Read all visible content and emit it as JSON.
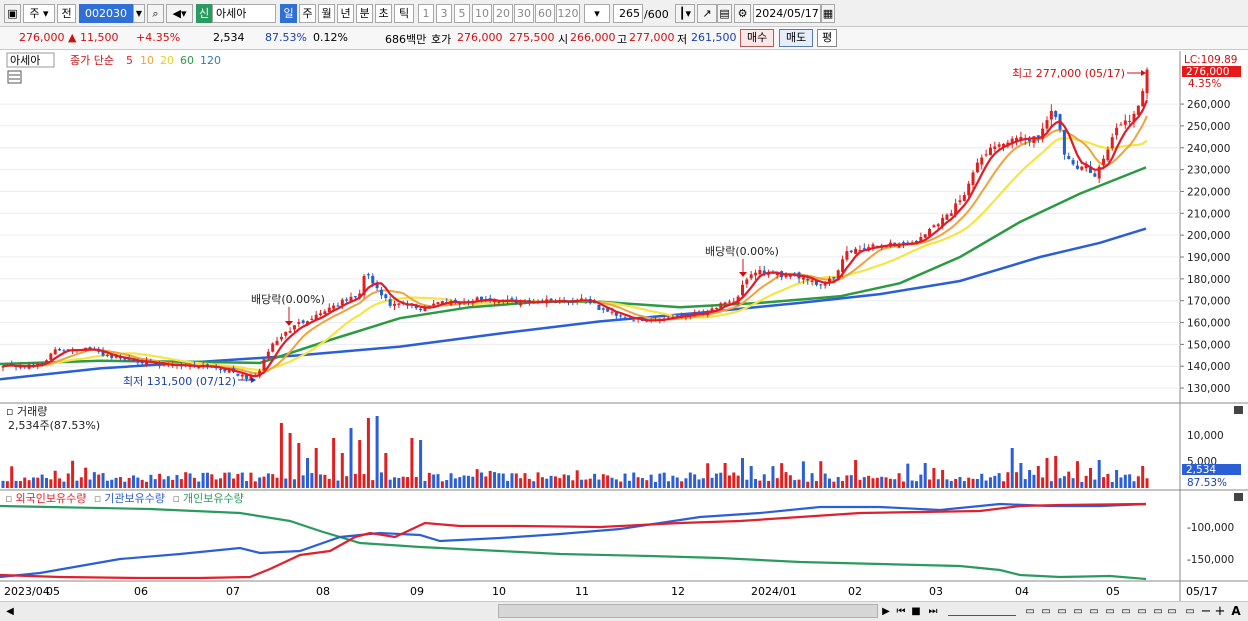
{
  "toolbar": {
    "market_type": "주",
    "prev_label": "전",
    "code": "002030",
    "search_icon": "magnifier-icon",
    "sound_icon": "speaker-icon",
    "new_label": "신",
    "stock_name": "아세아",
    "periods": [
      "일",
      "주",
      "월",
      "년",
      "분",
      "초",
      "틱"
    ],
    "selected_period": "일",
    "intervals": [
      "1",
      "3",
      "5",
      "10",
      "20",
      "30",
      "60",
      "120"
    ],
    "count": "265",
    "total": "/600",
    "date": "2024/05/17"
  },
  "infobar": {
    "price": "276,000",
    "change": "▲ 11,500",
    "change_pct": "+4.35%",
    "volume": "2,534",
    "volume_ratio": "87.53%",
    "turnover": "0.12%",
    "trade_value": "686백만",
    "bid_label": "호가",
    "bid": "276,000",
    "ask": "275,500",
    "open_label": "시",
    "open": "266,000",
    "high_label": "고",
    "high": "277,000",
    "low_label": "저",
    "low": "261,500",
    "buy_button": "매수",
    "sell_button": "매도",
    "avg_button": "평"
  },
  "price_panel": {
    "name": "아세아",
    "ma_title": "종가 단순",
    "ma_periods": [
      "5",
      "10",
      "20",
      "60",
      "120"
    ],
    "ma_colors": [
      "#e8202c",
      "#f0a23c",
      "#f4e542",
      "#2b9a43",
      "#2b5fd6"
    ],
    "lc_label": "LC:109.89",
    "current_tag": "276,000",
    "pct_tag": "4.35%",
    "high_note": "최고 277,000 (05/17)",
    "low_note": "최저 131,500 (07/12)",
    "dividend_note_1": "배당락(0.00%)",
    "dividend_note_2": "배당락(0.00%)"
  },
  "volume_panel": {
    "title": "거래량",
    "summary": "2,534주(87.53%)",
    "current_tag": "2,534",
    "pct_tag": "87.53%",
    "axis": [
      "10,000",
      "5,000"
    ]
  },
  "holding_panel": {
    "legend": [
      {
        "label": "외국인보유수량",
        "color": "#e8202c"
      },
      {
        "label": "기관보유수량",
        "color": "#2b5fd6"
      },
      {
        "label": "개인보유수량",
        "color": "#2b9a5e"
      }
    ],
    "axis": [
      "-100,000",
      "-150,000"
    ]
  },
  "x_axis": [
    "2023/04",
    "05",
    "06",
    "07",
    "08",
    "09",
    "10",
    "11",
    "12",
    "2024/01",
    "02",
    "03",
    "04",
    "05",
    "05/17"
  ],
  "chart_data": {
    "type": "candlestick",
    "ylabel_ticks": [
      130000,
      140000,
      150000,
      160000,
      170000,
      180000,
      190000,
      200000,
      210000,
      220000,
      230000,
      240000,
      250000,
      260000
    ],
    "ylim": [
      125000,
      282000
    ],
    "close_path": [
      [
        0,
        141000
      ],
      [
        15,
        140000
      ],
      [
        30,
        140000
      ],
      [
        42,
        141500
      ],
      [
        55,
        147000
      ],
      [
        70,
        148000
      ],
      [
        85,
        148000
      ],
      [
        100,
        146000
      ],
      [
        115,
        144000
      ],
      [
        130,
        143000
      ],
      [
        145,
        142000
      ],
      [
        160,
        140000
      ],
      [
        175,
        141000
      ],
      [
        190,
        140000
      ],
      [
        205,
        140500
      ],
      [
        220,
        139000
      ],
      [
        235,
        137000
      ],
      [
        248,
        134000
      ],
      [
        260,
        138000
      ],
      [
        270,
        149000
      ],
      [
        285,
        155000
      ],
      [
        300,
        160000
      ],
      [
        315,
        163000
      ],
      [
        330,
        167000
      ],
      [
        345,
        170000
      ],
      [
        360,
        173000
      ],
      [
        366,
        184000
      ],
      [
        375,
        176000
      ],
      [
        390,
        168000
      ],
      [
        405,
        168000
      ],
      [
        420,
        166000
      ],
      [
        435,
        169000
      ],
      [
        450,
        170000
      ],
      [
        465,
        169000
      ],
      [
        480,
        171000
      ],
      [
        495,
        170000
      ],
      [
        510,
        170000
      ],
      [
        525,
        169000
      ],
      [
        540,
        170000
      ],
      [
        555,
        170000
      ],
      [
        570,
        170000
      ],
      [
        585,
        171000
      ],
      [
        600,
        166000
      ],
      [
        615,
        164000
      ],
      [
        630,
        162000
      ],
      [
        645,
        160000
      ],
      [
        660,
        162000
      ],
      [
        675,
        163000
      ],
      [
        690,
        164000
      ],
      [
        705,
        165000
      ],
      [
        720,
        168000
      ],
      [
        735,
        169000
      ],
      [
        745,
        180000
      ],
      [
        760,
        183000
      ],
      [
        775,
        182000
      ],
      [
        790,
        181000
      ],
      [
        805,
        181000
      ],
      [
        820,
        177000
      ],
      [
        835,
        181000
      ],
      [
        845,
        192000
      ],
      [
        860,
        193000
      ],
      [
        875,
        195000
      ],
      [
        890,
        196000
      ],
      [
        905,
        196000
      ],
      [
        920,
        198000
      ],
      [
        935,
        205000
      ],
      [
        950,
        210000
      ],
      [
        965,
        220000
      ],
      [
        975,
        230000
      ],
      [
        985,
        238000
      ],
      [
        995,
        241000
      ],
      [
        1010,
        243000
      ],
      [
        1025,
        244000
      ],
      [
        1040,
        245000
      ],
      [
        1050,
        258000
      ],
      [
        1058,
        252000
      ],
      [
        1065,
        236000
      ],
      [
        1075,
        230000
      ],
      [
        1085,
        232000
      ],
      [
        1095,
        228000
      ],
      [
        1105,
        236000
      ],
      [
        1115,
        248000
      ],
      [
        1125,
        252000
      ],
      [
        1135,
        255000
      ],
      [
        1142,
        262000
      ],
      [
        1146,
        276000
      ]
    ],
    "ma60_path": [
      [
        0,
        141000
      ],
      [
        100,
        142500
      ],
      [
        200,
        142000
      ],
      [
        260,
        141500
      ],
      [
        330,
        152000
      ],
      [
        400,
        162000
      ],
      [
        470,
        167000
      ],
      [
        540,
        169500
      ],
      [
        600,
        169500
      ],
      [
        680,
        167000
      ],
      [
        760,
        169000
      ],
      [
        840,
        172000
      ],
      [
        900,
        178000
      ],
      [
        960,
        190000
      ],
      [
        1020,
        206000
      ],
      [
        1080,
        219000
      ],
      [
        1146,
        231000
      ]
    ],
    "ma120_path": [
      [
        0,
        134000
      ],
      [
        100,
        139000
      ],
      [
        200,
        142000
      ],
      [
        300,
        145000
      ],
      [
        400,
        149000
      ],
      [
        500,
        155000
      ],
      [
        600,
        160500
      ],
      [
        700,
        164500
      ],
      [
        800,
        169000
      ],
      [
        880,
        173000
      ],
      [
        960,
        179000
      ],
      [
        1040,
        190000
      ],
      [
        1100,
        196500
      ],
      [
        1146,
        203000
      ]
    ]
  }
}
